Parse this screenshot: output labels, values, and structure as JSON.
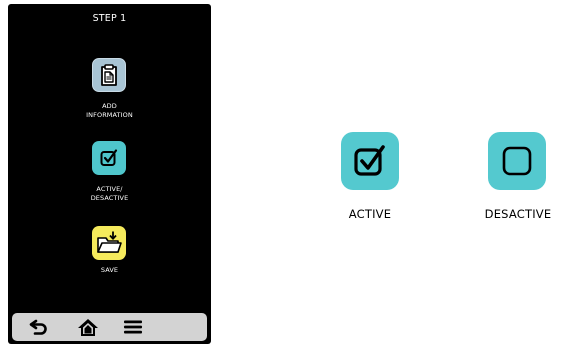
{
  "phone": {
    "step_title": "STEP 1",
    "menu": [
      {
        "label_line1": "ADD",
        "label_line2": "INFORMATION",
        "icon": "clipboard-icon",
        "color": "#a8c4d4"
      },
      {
        "label_line1": "ACTIVE/",
        "label_line2": "DESACTIVE",
        "icon": "checkbox-checked-icon",
        "color": "#4fc6cc"
      },
      {
        "label_line1": "SAVE",
        "label_line2": "",
        "icon": "folder-download-icon",
        "color": "#f5ea5c"
      }
    ],
    "bottom_bar": {
      "icons": [
        "back-icon",
        "home-icon",
        "hamburger-menu-icon"
      ],
      "color": "#d3d3d3"
    }
  },
  "legend": {
    "items": [
      {
        "label": "ACTIVE",
        "icon": "checkbox-checked-icon",
        "color": "#54c9cf"
      },
      {
        "label": "DESACTIVE",
        "icon": "checkbox-empty-icon",
        "color": "#54c9cf"
      }
    ]
  }
}
